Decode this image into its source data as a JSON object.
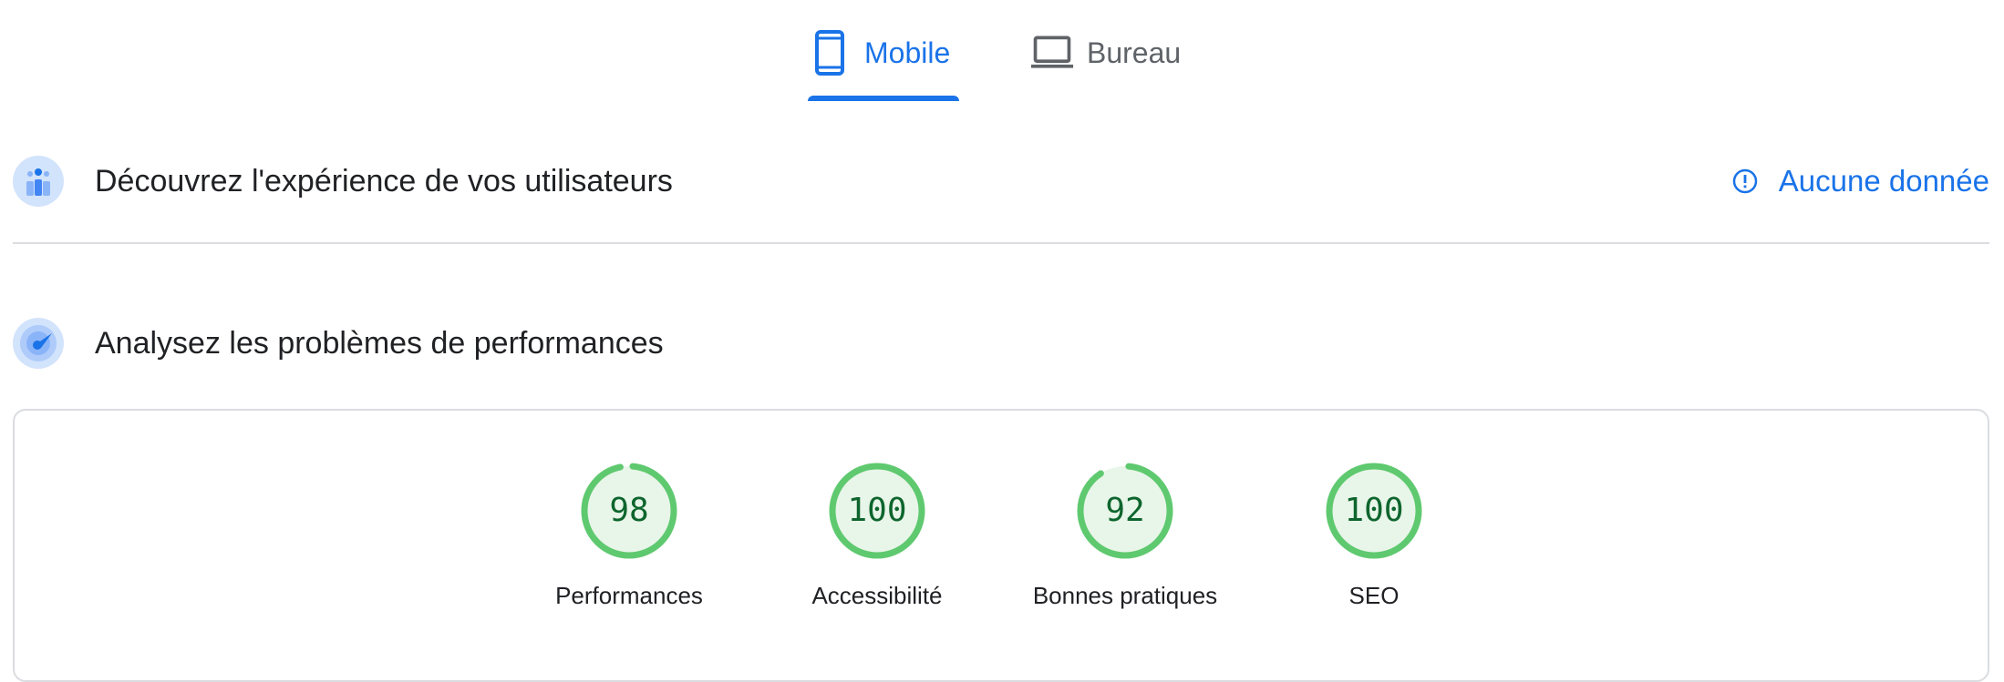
{
  "tabs": {
    "mobile": {
      "label": "Mobile",
      "icon": "smartphone-icon"
    },
    "desktop": {
      "label": "Bureau",
      "icon": "laptop-icon"
    },
    "selected": "mobile"
  },
  "field_data": {
    "title": "Découvrez l'expérience de vos utilisateurs",
    "status_label": "Aucune donnée",
    "icon": "users-chart-icon"
  },
  "lab_data": {
    "title": "Analysez les problèmes de performances",
    "icon": "speed-gauge-icon"
  },
  "scores": [
    {
      "label": "Performances",
      "value": 98
    },
    {
      "label": "Accessibilité",
      "value": 100
    },
    {
      "label": "Bonnes pratiques",
      "value": 92
    },
    {
      "label": "SEO",
      "value": 100
    }
  ],
  "colors": {
    "accent": "#1a73e8",
    "pass": "#0cce6b",
    "pass_ring": "#5fc96f",
    "pass_fill": "#e8f5e9",
    "pass_text": "#0d652d"
  }
}
